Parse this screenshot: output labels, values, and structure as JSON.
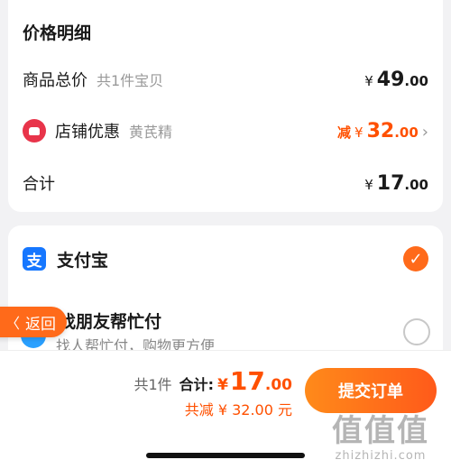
{
  "price_detail": {
    "title": "价格明细",
    "goods_total": {
      "label": "商品总价",
      "sub": "共1件宝贝",
      "currency": "¥",
      "int": "49",
      "dec": ".00"
    },
    "shop_discount": {
      "label": "店铺优惠",
      "sub": "黄芪精",
      "prefix": "减",
      "currency": "¥",
      "int": "32",
      "dec": ".00",
      "chevron": "›"
    },
    "total": {
      "label": "合计",
      "currency": "¥",
      "int": "17",
      "dec": ".00"
    }
  },
  "payment": {
    "alipay": {
      "icon_text": "支",
      "label": "支付宝",
      "checkmark": "✓"
    },
    "friend": {
      "title": "找朋友帮忙付",
      "subtitle": "找人帮忙付，购物更方便"
    }
  },
  "back_button": {
    "arrow": "〈",
    "label": "返回"
  },
  "bottom_bar": {
    "count": "共1件",
    "total_label": "合计:",
    "currency": "¥",
    "int": "17",
    "dec": ".00",
    "saved": "共减 ¥ 32.00 元",
    "submit_label": "提交订单"
  },
  "watermark": {
    "big": "值值值",
    "small": "zhizhizhi.com"
  },
  "colors": {
    "accent": "#ff5000",
    "alipay_blue": "#1677ff",
    "shop_red": "#e8344a"
  }
}
